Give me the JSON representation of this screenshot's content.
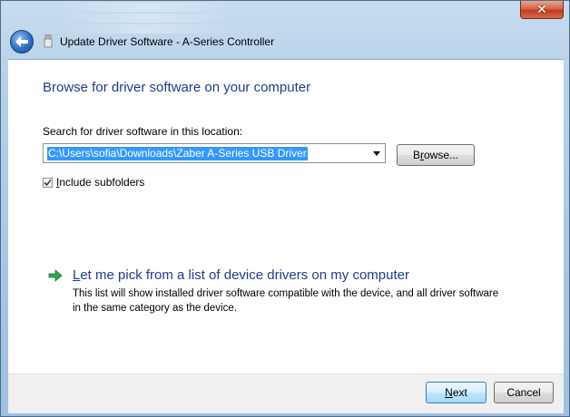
{
  "window": {
    "title": "Update Driver Software - A-Series Controller",
    "close_glyph": "✕"
  },
  "page": {
    "heading": "Browse for driver software on your computer",
    "search_label": "Search for driver software in this location:",
    "path_value": "C:\\Users\\sofia\\Downloads\\Zaber A-Series USB Driver",
    "browse_label_pre": "B",
    "browse_label_u": "r",
    "browse_label_post": "owse...",
    "include_subfolders_pre": "",
    "include_subfolders_u": "I",
    "include_subfolders_post": "nclude subfolders",
    "include_subfolders_checked": true,
    "pick_link_pre": "",
    "pick_link_u": "L",
    "pick_link_post": "et me pick from a list of device drivers on my computer",
    "pick_description": "This list will show installed driver software compatible with the device, and all driver software in the same category as the device."
  },
  "footer": {
    "next_u": "N",
    "next_post": "ext",
    "cancel_label": "Cancel"
  },
  "colors": {
    "heading": "#1f3d8c",
    "selection": "#3399ff",
    "link_arrow": "#2fa84f"
  },
  "icons": [
    "back-arrow-icon",
    "usb-device-icon",
    "dropdown-arrow-icon",
    "checkmark-icon",
    "green-arrow-icon",
    "close-icon"
  ]
}
